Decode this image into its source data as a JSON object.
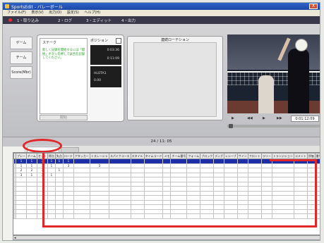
{
  "window": {
    "title": "SportsEdit - バレーボール",
    "close_glyph": "X"
  },
  "menu": [
    "ファイル(F)",
    "表示(V)",
    "出力(O)",
    "設定(S)",
    "ヘルプ(H)"
  ],
  "modes": [
    "1・取り込み",
    "2・ログ",
    "3・エディット",
    "4・出力"
  ],
  "side_tabs": [
    "ゲーム",
    "チーム",
    "Score(Mbr)"
  ],
  "step_panel": {
    "header": "ステーク",
    "body": "新しく記録を開始するには「開始」ボタンを押して試合を記録してください。",
    "start_button": "開始"
  },
  "position_panel": {
    "header": "ポジション",
    "value_1": "0:03:36",
    "value_2": "0:11:09",
    "value_3": "HLOTA1",
    "value_4": "0.00"
  },
  "rotation_panel": {
    "header": "連続ローテション"
  },
  "transport": {
    "buttons": [
      "▶",
      "◀◀",
      "▶",
      "▶▶"
    ],
    "timecode": "0:01:12:09"
  },
  "time_display": "24 / 11: 05",
  "table": {
    "headers": [
      "プレー",
      "チーム",
      "セット",
      "得点",
      "失点",
      "ローテ",
      "アタッカー",
      "トスレーシャ",
      "スパイクコース",
      "スタイル",
      "タイムコード",
      "メモ",
      "チーム番号",
      "フォーム",
      "ブロック",
      "ディグ",
      "レシーブ",
      "サイン",
      "フロント",
      "ラリー",
      "トランジション",
      "コメント",
      "評価",
      "番号"
    ],
    "rows": [
      [
        "1",
        "1",
        "3",
        "1",
        "1",
        "1",
        "",
        "",
        "",
        "",
        "",
        "",
        "",
        "",
        "",
        "",
        "",
        "",
        "",
        "",
        "",
        "",
        "",
        ""
      ],
      [
        "1",
        "1",
        "3",
        "1",
        "",
        "3",
        "",
        "3",
        "",
        "",
        "",
        "",
        "",
        "",
        "",
        "",
        "",
        "",
        "",
        "",
        "",
        "",
        "",
        ""
      ],
      [
        "2",
        "2",
        "3",
        "",
        "1",
        "",
        "",
        "",
        "",
        "",
        "",
        "",
        "",
        "",
        "",
        "",
        "",
        "",
        "",
        "",
        "",
        "",
        "",
        ""
      ],
      [
        "3",
        "1",
        "3",
        "1",
        "",
        "",
        "",
        "",
        "",
        "",
        "",
        "",
        "",
        "",
        "",
        "",
        "",
        "",
        "",
        "",
        "",
        "",
        "",
        ""
      ]
    ]
  },
  "colors": {
    "accent_red": "#e0282a",
    "selection_blue": "#1c2fa8",
    "title_blue": "#2f62c8"
  }
}
